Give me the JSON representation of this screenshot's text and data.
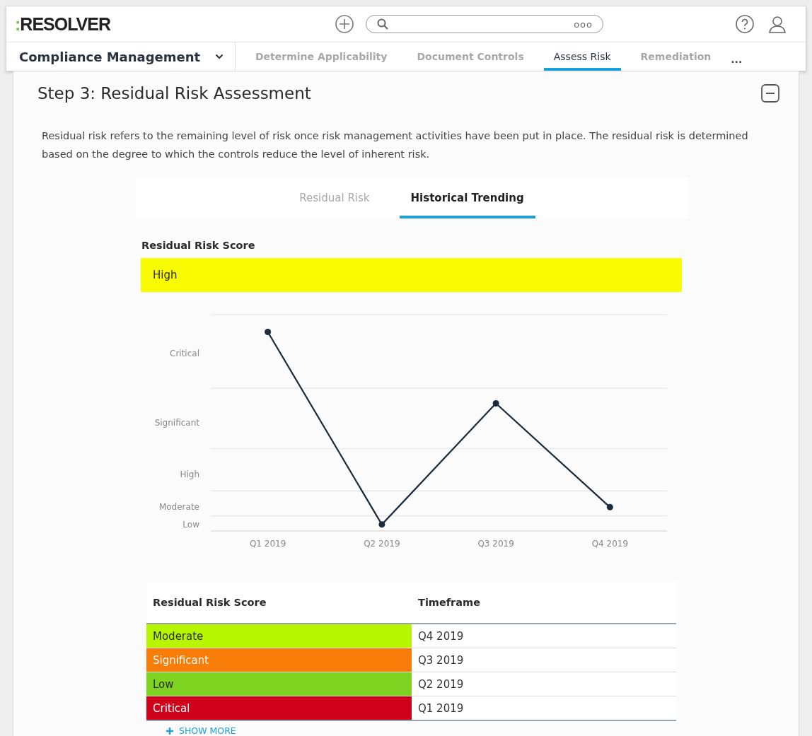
{
  "header": {
    "logo": {
      "mark": ":",
      "text": "RESOLVER"
    },
    "search": {
      "more": "ooo"
    }
  },
  "nav": {
    "app": "Compliance Management",
    "tabs": [
      {
        "label": "Determine Applicability",
        "selected": false
      },
      {
        "label": "Document Controls",
        "selected": false
      },
      {
        "label": "Assess Risk",
        "selected": true
      },
      {
        "label": "Remediation",
        "selected": false
      }
    ],
    "more": "..."
  },
  "section": {
    "title": "Step 3: Residual Risk Assessment",
    "description": "Residual risk refers to the remaining level of risk once risk management activities have been put in place. The residual risk is determined based on the degree to which the controls reduce the level of inherent risk.",
    "tabs": [
      {
        "label": "Residual Risk",
        "selected": false
      },
      {
        "label": "Historical Trending",
        "selected": true
      }
    ],
    "score": {
      "label": "Residual Risk Score",
      "value": "High",
      "color": "#f9fb00"
    },
    "trend_chart": {
      "x_labels": [
        "Q1 2019",
        "Q2 2019",
        "Q3 2019",
        "Q4 2019"
      ],
      "y_labels": [
        "Critical",
        "Significant",
        "High",
        "Moderate",
        "Low"
      ]
    },
    "table": {
      "columns": [
        "Residual Risk Score",
        "Timeframe"
      ],
      "rows": [
        {
          "score": "Moderate",
          "color": "#b8f600",
          "timeframe": "Q4 2019"
        },
        {
          "score": "Significant",
          "color": "#f87c08",
          "timeframe": "Q3 2019"
        },
        {
          "score": "Low",
          "color": "#7ed321",
          "timeframe": "Q2 2019"
        },
        {
          "score": "Critical",
          "color": "#d0021b",
          "timeframe": "Q1 2019"
        }
      ]
    },
    "show_more": "SHOW MORE"
  }
}
